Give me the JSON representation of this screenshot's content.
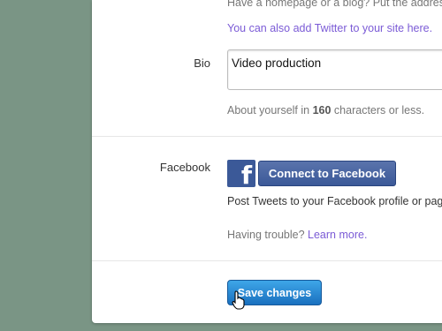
{
  "website": {
    "hint": "Have a homepage or a blog? Put the address",
    "twitter_link": "You can also add Twitter to your site here."
  },
  "bio": {
    "label": "Bio",
    "value": "Video production",
    "hint_prefix": "About yourself in ",
    "hint_count": "160",
    "hint_suffix": " characters or less."
  },
  "facebook": {
    "label": "Facebook",
    "logo_letter": "f",
    "connect_label": "Connect to Facebook",
    "description": "Post Tweets to your Facebook profile or page",
    "trouble_text": "Having trouble? ",
    "learn_more": "Learn more."
  },
  "save_label": "Save changes",
  "colors": {
    "background": "#7a9585",
    "link": "#7b5bd6",
    "facebook_blue": "#3b5998",
    "save_blue": "#1a70bf"
  }
}
